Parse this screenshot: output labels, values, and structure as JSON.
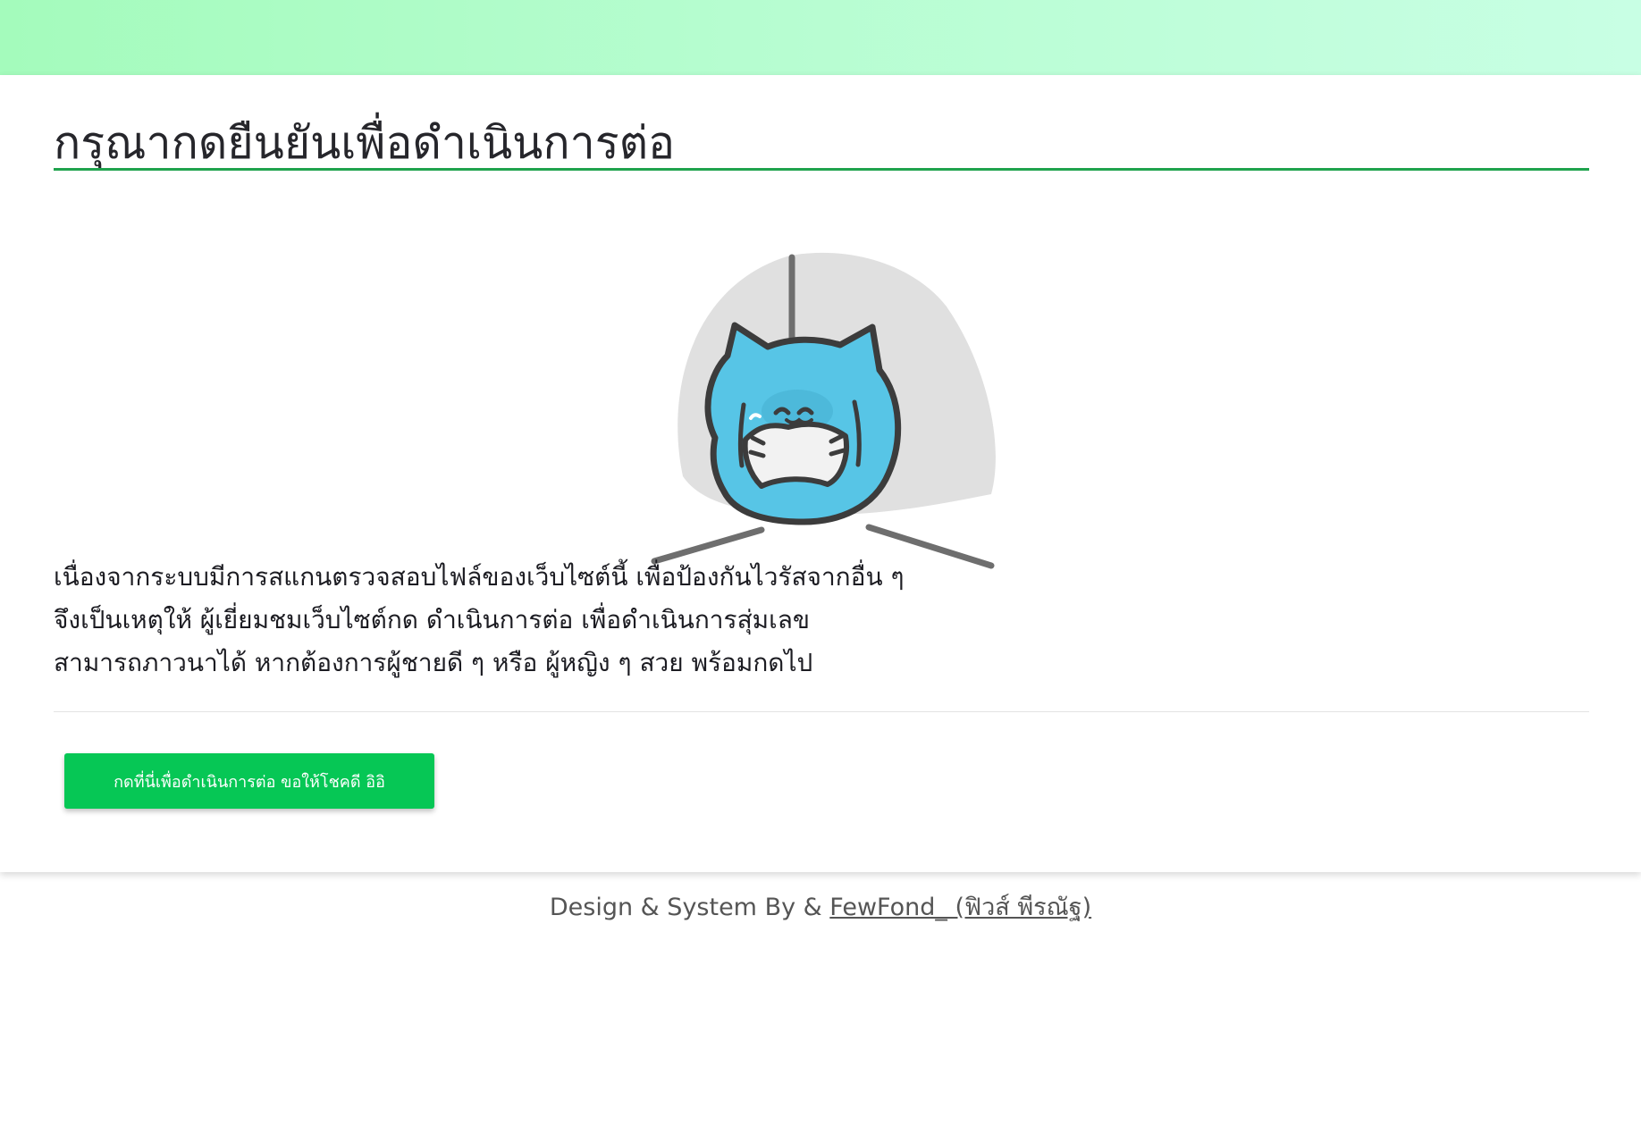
{
  "header": {
    "title": "กรุณากดยืนยันเพื่อดำเนินการต่อ"
  },
  "illustration": {
    "icon": "blue-cat-mascot-icon",
    "colors": {
      "backdrop": "#e0e0e0",
      "cat_body": "#57c5e6",
      "outline": "#3c3c3c"
    }
  },
  "message": {
    "lines": [
      "เนื่องจากระบบมีการสแกนตรวจสอบไฟล์ของเว็บไซต์นี้ เพื่อป้องกันไวรัสจากอื่น ๆ",
      "จึงเป็นเหตุให้ ผู้เยี่ยมชมเว็บไซต์กด ดำเนินการต่อ เพื่อดำเนินการสุ่มเลข",
      "สามารถภาวนาได้ หากต้องการผู้ชายดี ๆ หรือ ผู้หญิง ๆ สวย พร้อมกดไป"
    ]
  },
  "action": {
    "button_label": "กดที่นี่เพื่อดำเนินการต่อ ขอให้โชคดี อิอิ",
    "button_color": "#06c755"
  },
  "footer": {
    "prefix": "Design & System By & ",
    "author_link": "FewFond_ (ฟิวส์ พีรณัฐ)"
  },
  "theme": {
    "header_gradient": [
      "#a4fbbc",
      "#c8ffe4"
    ],
    "title_underline": "#1fa34d"
  }
}
